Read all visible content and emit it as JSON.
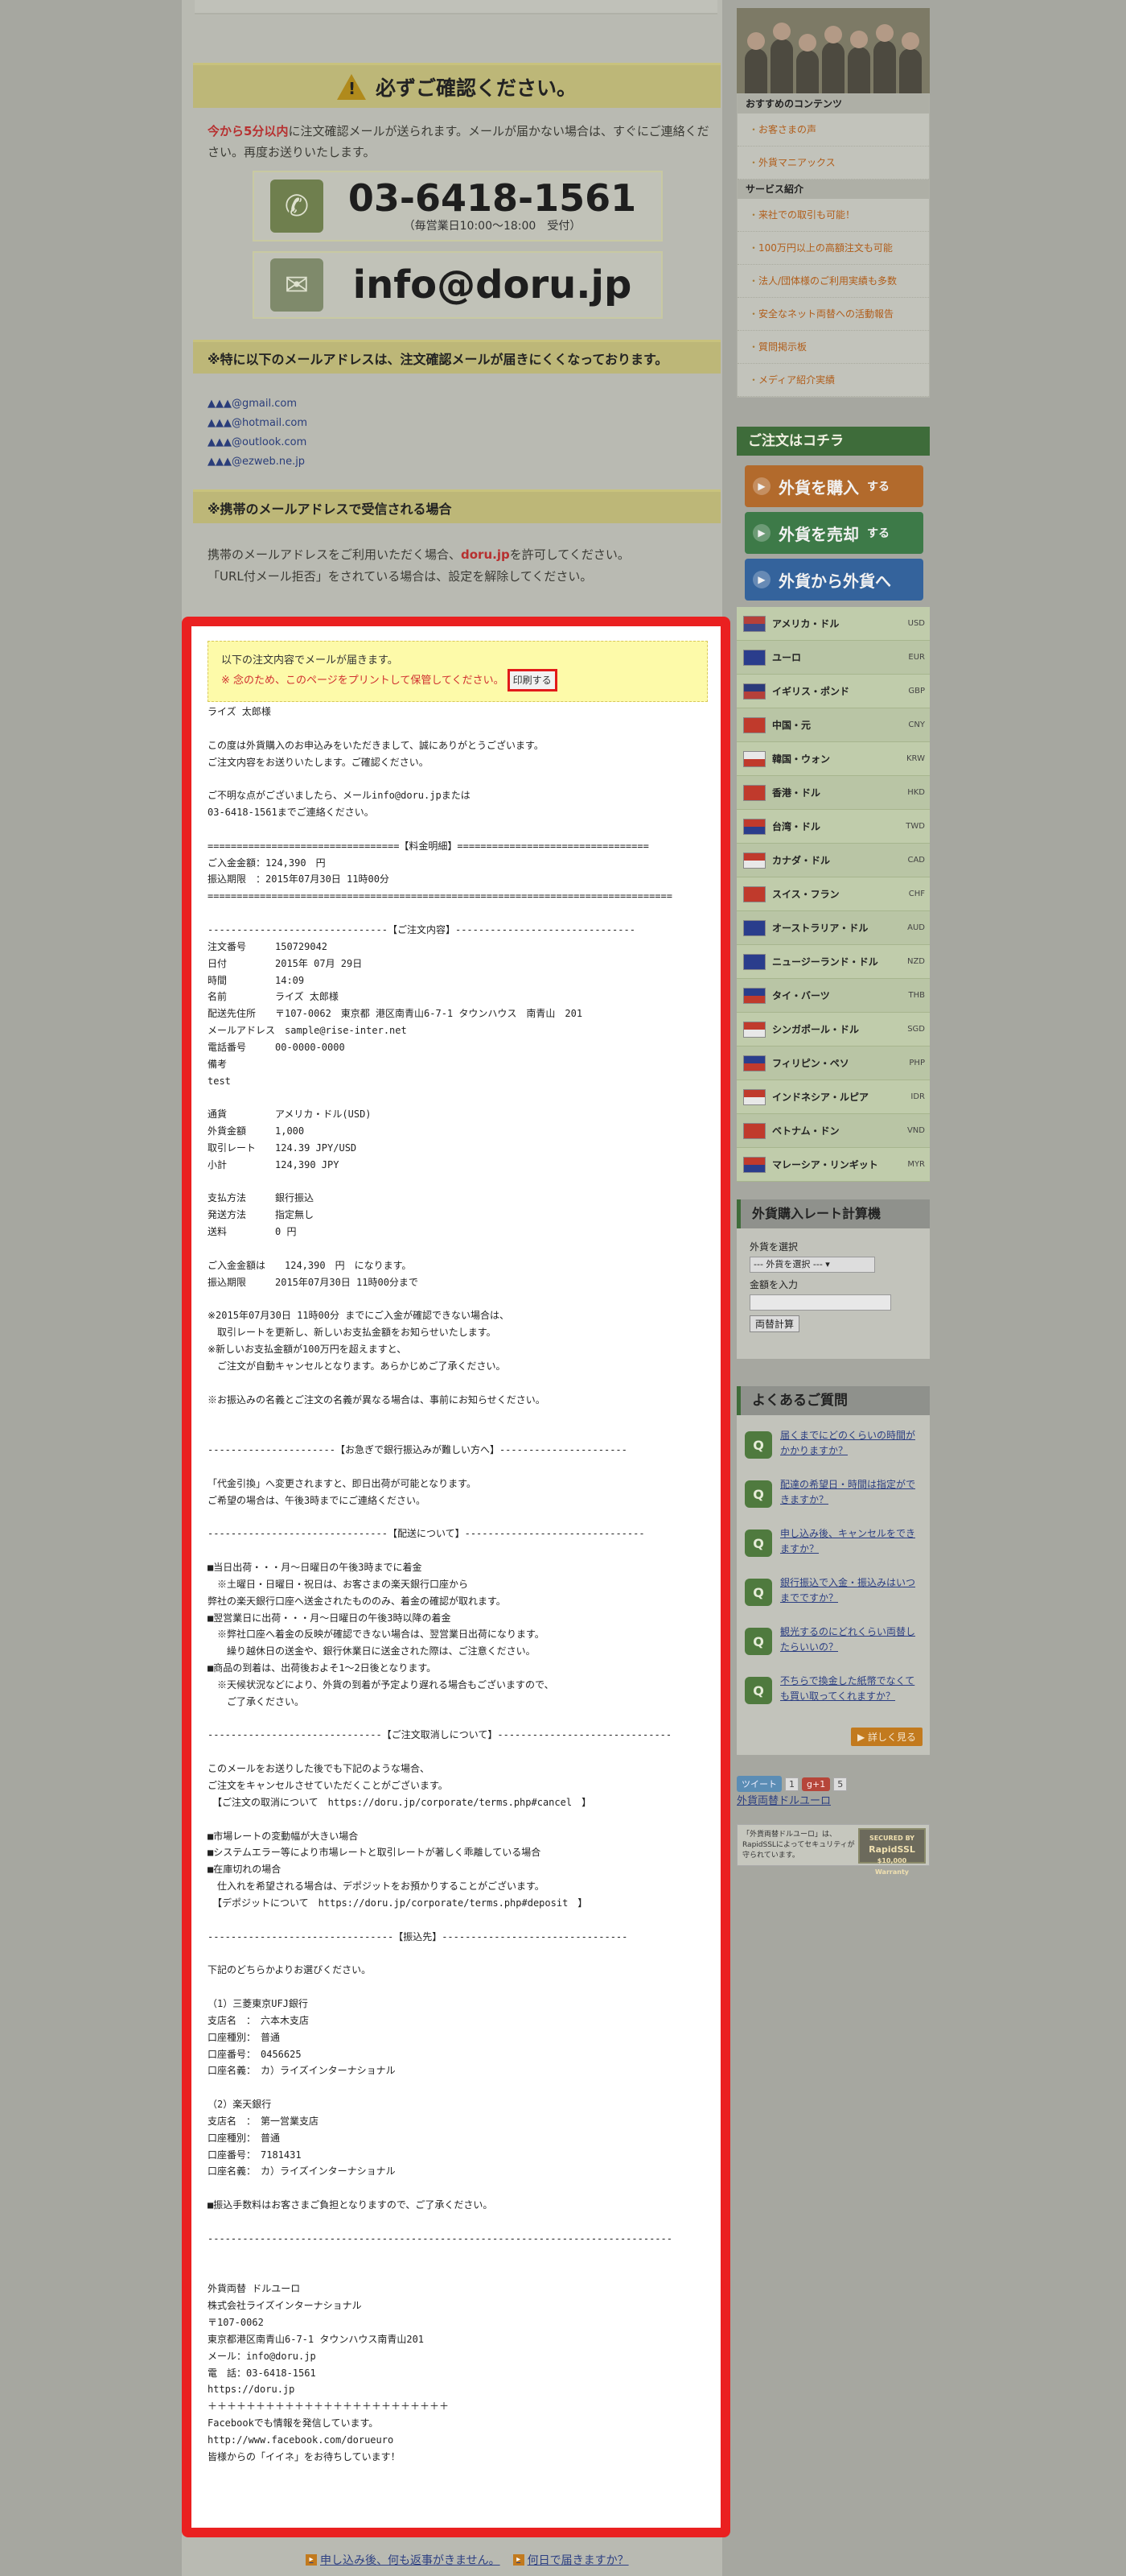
{
  "notice": {
    "title": "必ずご確認ください。",
    "text_red": "今から5分以内",
    "text_rest": "に注文確認メールが送られます。メールが届かない場合は、すぐにご連絡ください。再度お送りいたします。",
    "phone": "03-6418-1561",
    "hours": "（毎営業日10:00〜18:00　受付）",
    "email": "info@doru.jp"
  },
  "mail_domains": {
    "heading": "※特に以下のメールアドレスは、注文確認メールが届きにくくなっております。",
    "items": [
      "▲▲▲@gmail.com",
      "▲▲▲@hotmail.com",
      "▲▲▲@outlook.com",
      "▲▲▲@ezweb.ne.jp"
    ]
  },
  "mobile": {
    "heading": "※携帯のメールアドレスで受信される場合",
    "line1_a": "携帯のメールアドレスをご利用いただく場合、",
    "line1_red": "doru.jp",
    "line1_b": "を許可してください。",
    "line2": "「URL付メール拒否」をされている場合は、設定を解除してください。"
  },
  "preview": {
    "note_line1": "以下の注文内容でメールが届きます。",
    "note_line2": "※ 念のため、このページをプリントして保管してください。",
    "print_button": "印刷する",
    "body": "ライズ 太郎様\n\nこの度は外貨購入のお申込みをいただきまして、誠にありがとうございます。\nご注文内容をお送りいたします。ご確認ください。\n\nご不明な点がございましたら、メールinfo@doru.jpまたは\n03-6418-1561までご連絡ください。\n\n=================================【料金明細】=================================\nご入金金額：124,390　円\n振込期限　：2015年07月30日 11時00分\n================================================================================\n\n-------------------------------【ご注文内容】-------------------------------\n注文番号　　　150729042\n日付　　　　　2015年 07月 29日\n時間　　　　　14:09\n名前　　　　　ライズ 太郎様\n配送先住所　　〒107-0062　東京都 港区南青山6-7-1 タウンハウス　南青山　201\nメールアドレス　sample@rise-inter.net\n電話番号　　　00-0000-0000\n備考\ntest\n\n通貨　　　　　アメリカ・ドル(USD)\n外貨金額　　　1,000\n取引レート　　124.39 JPY/USD\n小計　　　　　124,390 JPY\n\n支払方法　　　銀行振込\n発送方法　　　指定無し\n送料　　　　　0 円\n\nご入金金額は　　124,390　円　になります。\n振込期限　　　2015年07月30日 11時00分まで\n\n※2015年07月30日 11時00分 までにご入金が確認できない場合は、\n　取引レートを更新し、新しいお支払金額をお知らせいたします。\n※新しいお支払金額が100万円を超えますと、\n　ご注文が自動キャンセルとなります。あらかじめご了承ください。\n\n※お振込みの名義とご注文の名義が異なる場合は、事前にお知らせください。\n\n\n----------------------【お急ぎで銀行振込みが難しい方へ】----------------------\n\n「代金引換」へ変更されますと、即日出荷が可能となります。\nご希望の場合は、午後3時までにご連絡ください。\n\n-------------------------------【配送について】-------------------------------\n\n■当日出荷・・・月〜日曜日の午後3時までに着金\n　※土曜日・日曜日・祝日は、お客さまの楽天銀行口座から\n弊社の楽天銀行口座へ送金されたもののみ、着金の確認が取れます。\n■翌営業日に出荷・・・月〜日曜日の午後3時以降の着金\n　※弊社口座へ着金の反映が確認できない場合は、翌営業日出荷になります。\n　　繰り越休日の送金や、銀行休業日に送金された際は、ご注意ください。\n■商品の到着は、出荷後およそ1〜2日後となります。\n　※天候状況などにより、外貨の到着が予定より遅れる場合もございますので、\n　　ご了承ください。\n\n------------------------------【ご注文取消しについて】------------------------------\n\nこのメールをお送りした後でも下記のような場合、\nご注文をキャンセルさせていただくことがございます。\n　【ご注文の取消について　https://doru.jp/corporate/terms.php#cancel　】\n\n■市場レートの変動幅が大きい場合\n■システムエラー等により市場レートと取引レートが著しく乖離している場合\n■在庫切れの場合\n　仕入れを希望される場合は、デポジットをお預かりすることがございます。\n　【デポジットについて　https://doru.jp/corporate/terms.php#deposit　】\n\n--------------------------------【振込先】--------------------------------\n\n下記のどちらかよりお選びください。\n\n（1）三菱東京UFJ銀行\n支店名　：　六本木支店\n口座種別：　普通\n口座番号：　0456625\n口座名義：　カ）ライズインターナショナル\n\n（2）楽天銀行\n支店名　：　第一営業支店\n口座種別：　普通\n口座番号：　7181431\n口座名義：　カ）ライズインターナショナル\n\n■振込手数料はお客さまご負担となりますので、ご了承ください。\n\n--------------------------------------------------------------------------------\n\n\n外貨両替 ドルユーロ\n株式会社ライズインターナショナル\n〒107-0062\n東京都港区南青山6-7-1 タウンハウス南青山201\nメール：info@doru.jp\n電　話：03-6418-1561\nhttps://doru.jp\n＋＋＋＋＋＋＋＋＋＋＋＋＋＋＋＋＋＋＋＋＋＋＋＋＋\nFacebookでも情報を発信しています。\nhttp://www.facebook.com/dorueuro\n皆様からの「イイネ」をお待ちしています！"
  },
  "sidebar": {
    "recommended_heading": "おすすめのコンテンツ",
    "recommended": [
      "お客さまの声",
      "外貨マニアックス"
    ],
    "services_heading": "サービス紹介",
    "services": [
      "来社での取引も可能！",
      "100万円以上の高額注文も可能",
      "法人/団体様のご利用実績も多数",
      "安全なネット両替への活動報告",
      "質問掲示板",
      "メディア紹介実績"
    ],
    "order_heading": "ご注文はコチラ",
    "order_buttons": [
      {
        "label": "外貨を購入",
        "suffix": "する"
      },
      {
        "label": "外貨を売却",
        "suffix": "する"
      },
      {
        "label": "外貨から外貨へ",
        "suffix": ""
      }
    ],
    "currencies": [
      {
        "name": "アメリカ・ドル",
        "code": "USD",
        "c1": "#b5403a",
        "c2": "#3b4a8a"
      },
      {
        "name": "ユーロ",
        "code": "EUR",
        "c1": "#2a3d8c",
        "c2": "#2a3d8c"
      },
      {
        "name": "イギリス・ポンド",
        "code": "GBP",
        "c1": "#2a3a7a",
        "c2": "#b5403a"
      },
      {
        "name": "中国・元",
        "code": "CNY",
        "c1": "#c03a2c",
        "c2": "#c03a2c"
      },
      {
        "name": "韓国・ウォン",
        "code": "KRW",
        "c1": "#e8e8e8",
        "c2": "#c03a2c"
      },
      {
        "name": "香港・ドル",
        "code": "HKD",
        "c1": "#c03a2c",
        "c2": "#c03a2c"
      },
      {
        "name": "台湾・ドル",
        "code": "TWD",
        "c1": "#c03a2c",
        "c2": "#2a3d8c"
      },
      {
        "name": "カナダ・ドル",
        "code": "CAD",
        "c1": "#c03a2c",
        "c2": "#e8e8e8"
      },
      {
        "name": "スイス・フラン",
        "code": "CHF",
        "c1": "#c03a2c",
        "c2": "#c03a2c"
      },
      {
        "name": "オーストラリア・ドル",
        "code": "AUD",
        "c1": "#2a3d8c",
        "c2": "#2a3d8c"
      },
      {
        "name": "ニュージーランド・ドル",
        "code": "NZD",
        "c1": "#2a3d8c",
        "c2": "#2a3d8c"
      },
      {
        "name": "タイ・バーツ",
        "code": "THB",
        "c1": "#2a3d8c",
        "c2": "#c03a2c"
      },
      {
        "name": "シンガポール・ドル",
        "code": "SGD",
        "c1": "#c03a2c",
        "c2": "#e8e8e8"
      },
      {
        "name": "フィリピン・ペソ",
        "code": "PHP",
        "c1": "#2a3d8c",
        "c2": "#c03a2c"
      },
      {
        "name": "インドネシア・ルピア",
        "code": "IDR",
        "c1": "#c03a2c",
        "c2": "#e8e8e8"
      },
      {
        "name": "ベトナム・ドン",
        "code": "VND",
        "c1": "#c03a2c",
        "c2": "#c03a2c"
      },
      {
        "name": "マレーシア・リンギット",
        "code": "MYR",
        "c1": "#c03a2c",
        "c2": "#2a3d8c"
      }
    ],
    "calc": {
      "heading": "外貨購入レート計算機",
      "select_label": "外貨を選択",
      "select_value": "--- 外貨を選択 ---",
      "amount_label": "金額を入力",
      "button": "両替計算"
    },
    "faq": {
      "heading": "よくあるご質問",
      "q_mark": "Q",
      "items": [
        "届くまでにどのくらいの時間がかかりますか？",
        "配達の希望日・時間は指定ができますか？",
        "申し込み後、キャンセルをできますか？",
        "銀行振込で入金・振込みはいつまでですか？",
        "観光するのにどれくらい両替したらいいの？",
        "不ちらで換金した紙幣でなくても買い取ってくれますか？"
      ],
      "more": "詳しく見る"
    },
    "social": {
      "tweet": "ツイート",
      "tweet_count": "1",
      "gplus": "g+1",
      "gplus_count": "5",
      "link": "外貨両替ドルユーロ"
    },
    "ssl": {
      "text": "「外貨両替ドルユーロ」は、RapidSSLによってセキュリティが守られています。",
      "badge_line1": "SECURED BY",
      "badge_line2": "RapidSSL",
      "badge_line3": "$10,000 Warranty"
    }
  },
  "footer": {
    "link1": "申し込み後、何も返事がきません。",
    "link2": "何日で届きますか？"
  }
}
